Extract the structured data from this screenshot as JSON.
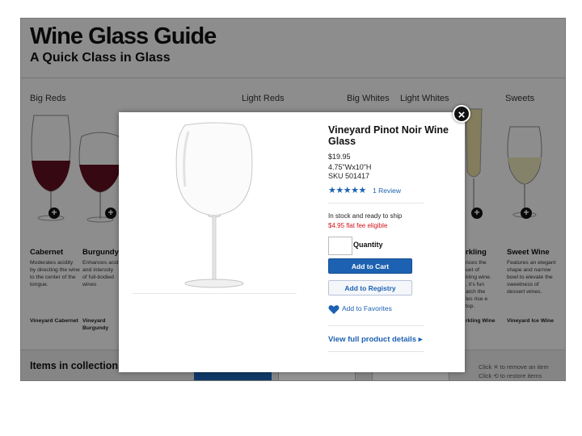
{
  "page": {
    "title": "Wine Glass Guide",
    "subtitle": "A Quick Class in Glass"
  },
  "categories": [
    "Big Reds",
    "Light Reds",
    "Big Whites",
    "Light Whites",
    "Sweets"
  ],
  "wines": [
    {
      "name": "Cabernet",
      "description": "Moderates acidity by directing the wine to the center of the tongue.",
      "link": "Vineyard Cabernet"
    },
    {
      "name": "Burgundy",
      "description": "Enhances acid and intensity of full-bodied wines",
      "link": "Vineyard Burgundy"
    },
    {
      "name": "rkling",
      "description": "nces the uet of kling wine. , it's fun atch the les rise e top.",
      "link": "rkling Wine"
    },
    {
      "name": "Sweet Wine",
      "description": "Features an elegant shape and narrow bowl to elevate the sweetness of dessert wines.",
      "link": "Vineyard Ice Wine"
    }
  ],
  "collection": {
    "label": "Items in collection:",
    "hint_remove": "Click ✕ to remove an item",
    "hint_restore": "Click ⟲ to restore items"
  },
  "modal": {
    "close_label": "×",
    "product_name": "Vineyard Pinot Noir Wine Glass",
    "price": "$19.95",
    "dimensions": "4.75\"Wx10\"H",
    "sku": "SKU 501417",
    "rating_stars": "★★★★★",
    "rating": 5,
    "reviews": "1 Review",
    "stock": "In stock and ready to ship",
    "fee": "$4.95 flat fee eligible",
    "quantity_label": "Quantity",
    "quantity_value": "",
    "add_to_cart": "Add to Cart",
    "add_to_registry": "Add to Registry",
    "add_to_favorites": "Add to Favorites",
    "view_details": "View full product details ▸"
  },
  "colors": {
    "accent": "#1d62b2",
    "fee": "#d3141b",
    "red_wine": "#5e0f1f",
    "white_wine": "#e3e0b4"
  }
}
